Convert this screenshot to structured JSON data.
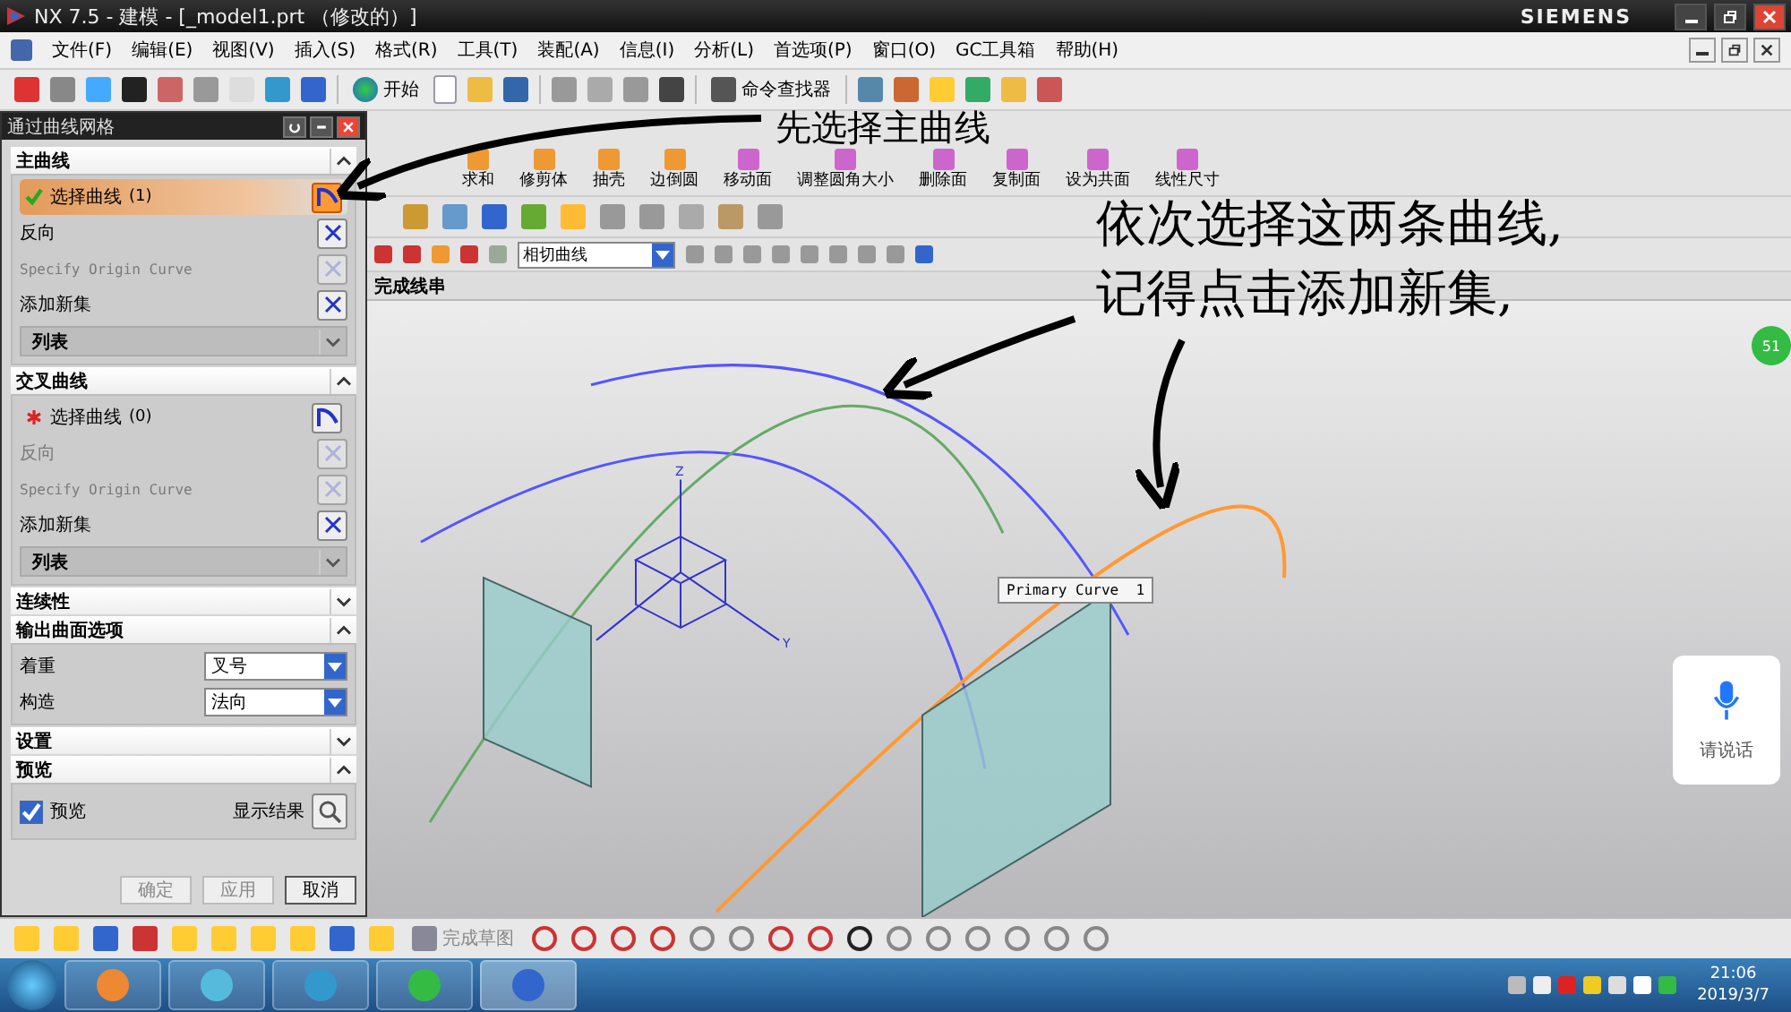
{
  "window": {
    "title": "NX 7.5 - 建模 - [_model1.prt （修改的）]",
    "brand": "SIEMENS"
  },
  "menu": [
    "文件(F)",
    "编辑(E)",
    "视图(V)",
    "插入(S)",
    "格式(R)",
    "工具(T)",
    "装配(A)",
    "信息(I)",
    "分析(L)",
    "首选项(P)",
    "窗口(O)",
    "GC工具箱",
    "帮助(H)"
  ],
  "toolbar": {
    "start": "开始",
    "finder": "命令查找器"
  },
  "ribbon": [
    "求和",
    "修剪体",
    "抽壳",
    "边倒圆",
    "移动面",
    "调整圆角大小",
    "删除面",
    "复制面",
    "设为共面",
    "线性尺寸"
  ],
  "filter": {
    "value": "相切曲线"
  },
  "cue": "完成线串",
  "dialog": {
    "title": "通过曲线网格",
    "sections": [
      {
        "title": "主曲线",
        "expanded": true,
        "rows": [
          {
            "kind": "select",
            "label": "选择曲线",
            "count": "(1)",
            "done": true,
            "selected": true
          },
          {
            "kind": "action",
            "label": "反向",
            "disabled": false
          },
          {
            "kind": "action",
            "label": "Specify Origin Curve",
            "disabled": true
          },
          {
            "kind": "action",
            "label": "添加新集",
            "disabled": false
          },
          {
            "kind": "list",
            "label": "列表"
          }
        ]
      },
      {
        "title": "交叉曲线",
        "expanded": true,
        "rows": [
          {
            "kind": "select",
            "label": "选择曲线",
            "count": "(0)",
            "done": false,
            "selected": false
          },
          {
            "kind": "action",
            "label": "反向",
            "disabled": true
          },
          {
            "kind": "action",
            "label": "Specify Origin Curve",
            "disabled": true
          },
          {
            "kind": "action",
            "label": "添加新集",
            "disabled": false
          },
          {
            "kind": "list",
            "label": "列表"
          }
        ]
      },
      {
        "title": "连续性",
        "expanded": false
      },
      {
        "title": "输出曲面选项",
        "expanded": true,
        "rows": [
          {
            "kind": "dropdown",
            "label": "着重",
            "value": "叉号"
          },
          {
            "kind": "dropdown",
            "label": "构造",
            "value": "法向"
          }
        ]
      },
      {
        "title": "设置",
        "expanded": false
      },
      {
        "title": "预览",
        "expanded": true,
        "rows": [
          {
            "kind": "preview",
            "label": "预览",
            "checked": true,
            "action": "显示结果"
          }
        ]
      }
    ],
    "buttons": [
      {
        "label": "确定",
        "disabled": true
      },
      {
        "label": "应用",
        "disabled": true
      },
      {
        "label": "取消",
        "disabled": false
      }
    ]
  },
  "canvas": {
    "tooltip": "Primary Curve  1",
    "axes": [
      "Z",
      "Y"
    ],
    "badge": "51",
    "voice": "请说话"
  },
  "annotations": [
    "先选择主曲线",
    "依次选择这两条曲线,",
    "记得点击添加新集,"
  ],
  "sketch_toolbar": {
    "finish": "完成草图"
  },
  "taskbar": {
    "time": "21:06",
    "date": "2019/3/7"
  }
}
